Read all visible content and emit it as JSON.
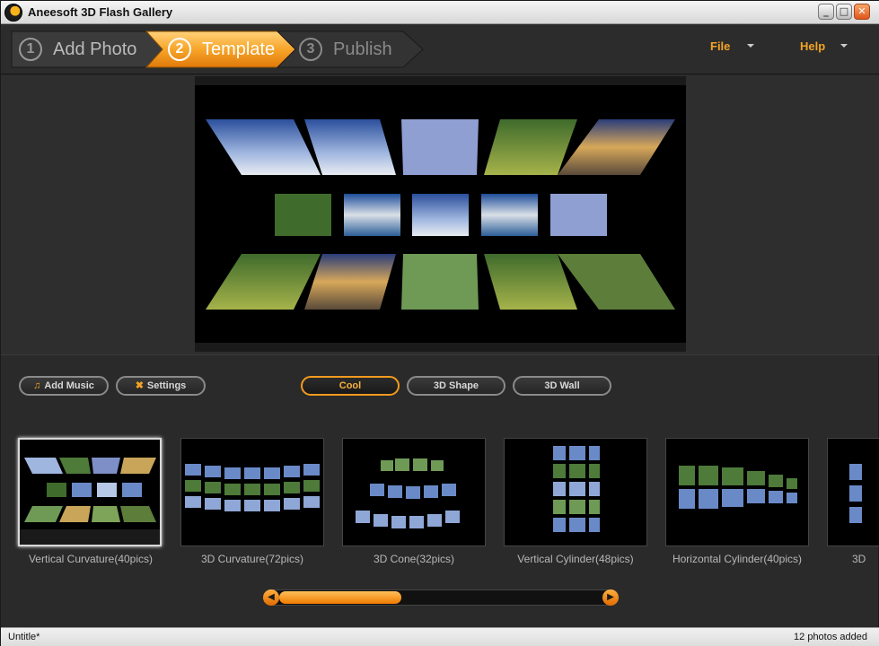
{
  "window": {
    "title": "Aneesoft 3D Flash Gallery"
  },
  "steps": [
    {
      "number": "1",
      "label": "Add Photo"
    },
    {
      "number": "2",
      "label": "Template"
    },
    {
      "number": "3",
      "label": "Publish"
    }
  ],
  "menu": {
    "file_label": "File",
    "help_label": "Help"
  },
  "toolbar": {
    "add_music_label": "Add Music",
    "settings_label": "Settings"
  },
  "template_tabs": [
    {
      "label": "Cool",
      "active": true
    },
    {
      "label": "3D Shape",
      "active": false
    },
    {
      "label": "3D Wall",
      "active": false
    }
  ],
  "templates": [
    {
      "label": "Vertical Curvature(40pics)",
      "selected": true
    },
    {
      "label": "3D Curvature(72pics)",
      "selected": false
    },
    {
      "label": "3D Cone(32pics)",
      "selected": false
    },
    {
      "label": "Vertical Cylinder(48pics)",
      "selected": false
    },
    {
      "label": "Horizontal Cylinder(40pics)",
      "selected": false
    },
    {
      "label": "3D",
      "selected": false
    }
  ],
  "status": {
    "file_name": "Untitle*",
    "photo_count": "12 photos added"
  },
  "colors": {
    "accent": "#f39a1e",
    "background": "#2a2a2a"
  }
}
